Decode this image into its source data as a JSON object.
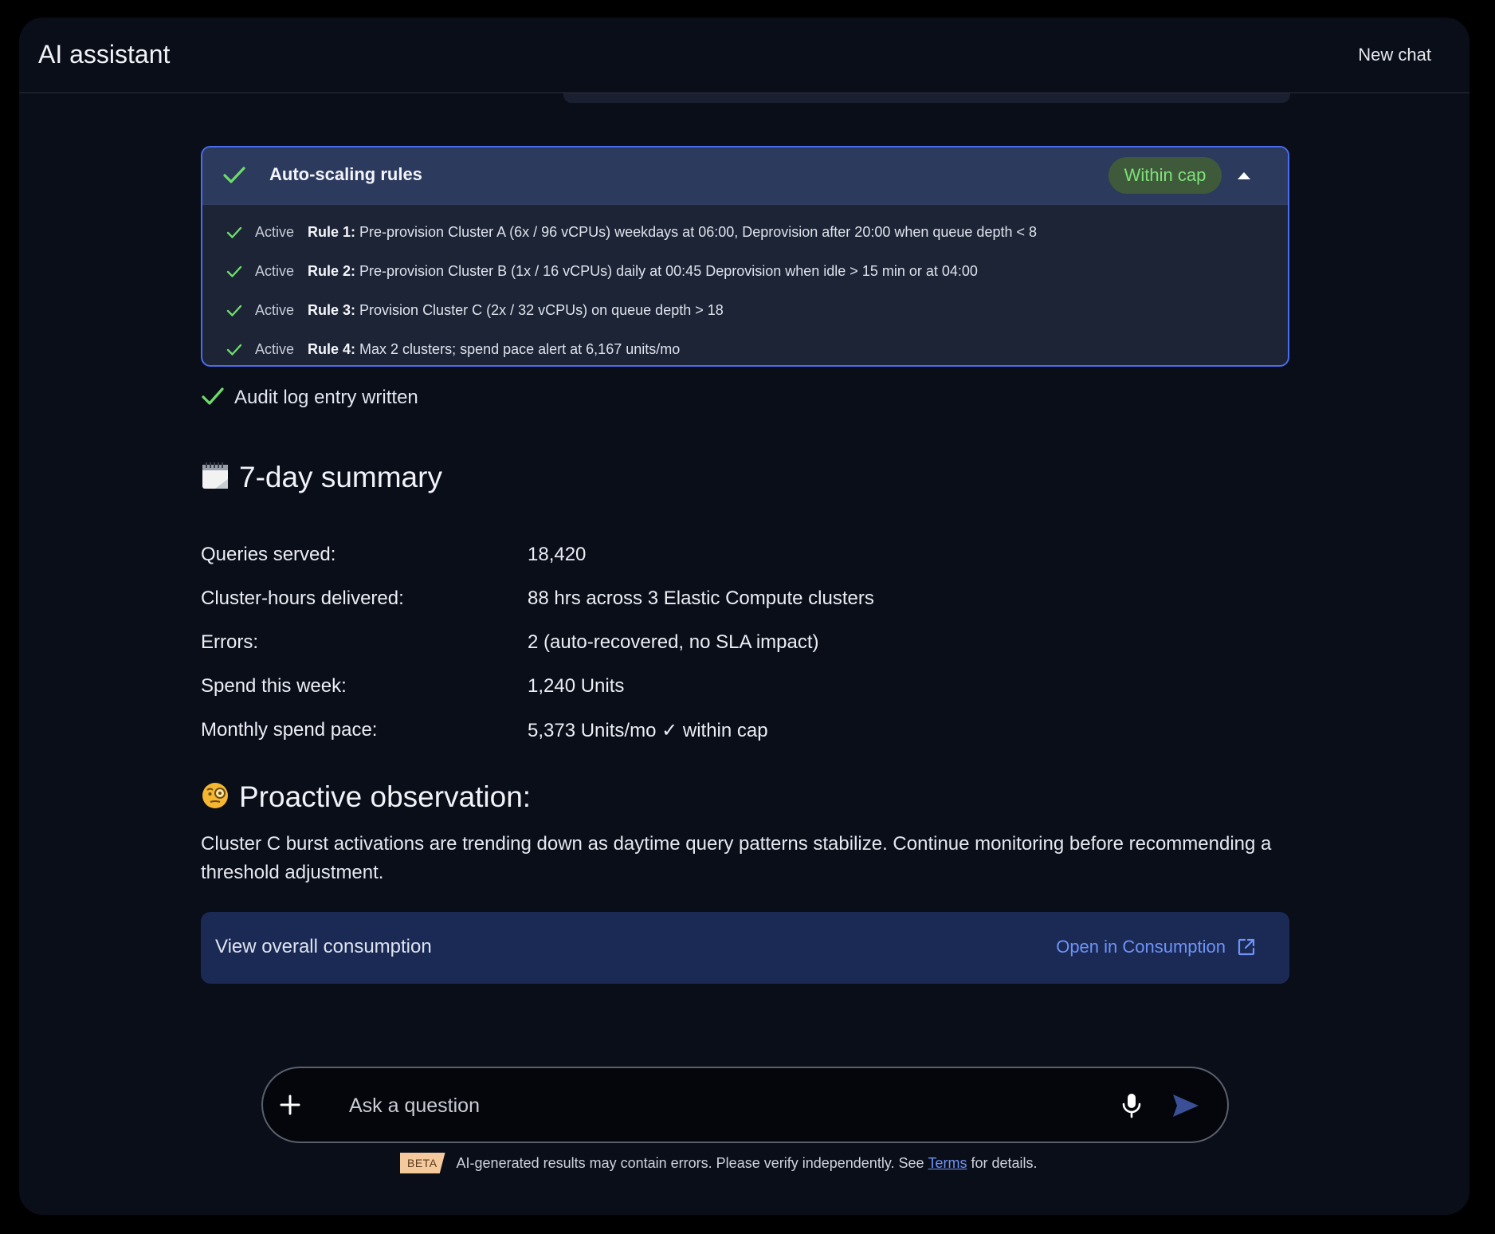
{
  "header": {
    "title": "AI assistant",
    "new_chat_label": "New chat"
  },
  "rules_card": {
    "title": "Auto-scaling rules",
    "badge": "Within cap",
    "rules": [
      {
        "status": "Active",
        "name": "Rule 1:",
        "text": "Pre-provision Cluster A (6x / 96 vCPUs) weekdays at 06:00, Deprovision after 20:00 when queue depth < 8"
      },
      {
        "status": "Active",
        "name": "Rule 2:",
        "text": "Pre-provision Cluster B (1x / 16 vCPUs) daily at 00:45 Deprovision when idle > 15 min or at 04:00"
      },
      {
        "status": "Active",
        "name": "Rule 3:",
        "text": "Provision Cluster C (2x / 32 vCPUs) on queue depth > 18"
      },
      {
        "status": "Active",
        "name": "Rule 4:",
        "text": "Max 2 clusters; spend pace alert at 6,167 units/mo"
      }
    ]
  },
  "audit_text": "Audit log entry written",
  "summary": {
    "title": "7-day summary",
    "rows": [
      {
        "label": "Queries served:",
        "value": "18,420"
      },
      {
        "label": "Cluster-hours delivered:",
        "value": "88 hrs across 3 Elastic Compute clusters"
      },
      {
        "label": "Errors:",
        "value": "2 (auto-recovered, no SLA impact)"
      },
      {
        "label": "Spend this week:",
        "value": "1,240 Units"
      },
      {
        "label": "Monthly spend pace:",
        "value": " 5,373 Units/mo ✓ within cap"
      }
    ]
  },
  "observation": {
    "title": "Proactive observation:",
    "text": "Cluster C burst activations are trending down as daytime query patterns stabilize. Continue monitoring before recommending a threshold adjustment."
  },
  "consumption": {
    "label": "View overall consumption",
    "link": "Open in Consumption"
  },
  "input": {
    "placeholder": "Ask a question"
  },
  "footer": {
    "beta": "BETA",
    "before_link": "AI-generated results may contain errors. Please verify independently. See",
    "link": "Terms",
    "after_link": "for details."
  },
  "colors": {
    "accent_blue": "#4a6cf0",
    "link_blue": "#6f93f7",
    "success_green": "#7fe07a",
    "panel_bg": "#0a0e19"
  }
}
